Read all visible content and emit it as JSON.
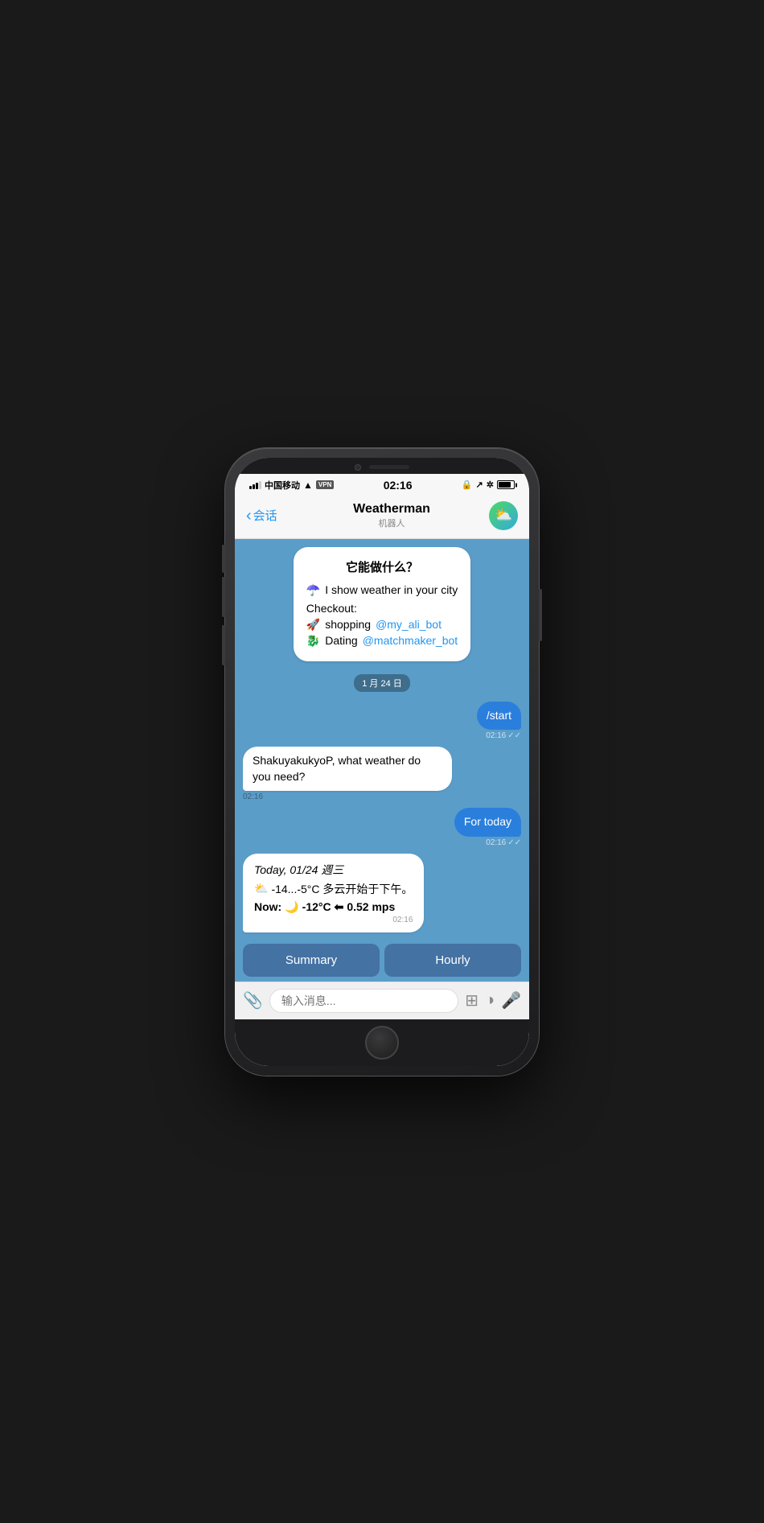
{
  "phone": {
    "camera_area": true
  },
  "status_bar": {
    "carrier": "中国移动",
    "wifi": "wifi",
    "vpn": "VPN",
    "time": "02:16",
    "lock_icon": "🔒",
    "location_icon": "↗",
    "bluetooth_icon": "✲"
  },
  "header": {
    "back_label": "会话",
    "title": "Weatherman",
    "subtitle": "机器人",
    "avatar_icon": "⛅"
  },
  "welcome_bubble": {
    "title": "它能做什么？",
    "line1_emoji": "☂️",
    "line1_text": "I show weather in your city",
    "checkout_label": "Checkout:",
    "item1_emoji": "🚀",
    "item1_text": "shopping",
    "item1_link": "@my_ali_bot",
    "item2_emoji": "🐉",
    "item2_text": "Dating",
    "item2_link": "@matchmaker_bot"
  },
  "date_separator": {
    "label": "1 月 24 日"
  },
  "messages": [
    {
      "id": "msg1",
      "type": "outgoing",
      "text": "/start",
      "time": "02:16",
      "read": true
    },
    {
      "id": "msg2",
      "type": "incoming",
      "text": "ShakuyakukyoP, what weather do you need?",
      "time": "02:16"
    },
    {
      "id": "msg3",
      "type": "outgoing",
      "text": "For today",
      "time": "02:16",
      "read": true
    },
    {
      "id": "msg4",
      "type": "weather",
      "date_line": "Today, 01/24 週三",
      "emoji_cloud": "⛅",
      "temp_range": "-14...-5°C 多云开始于下午。",
      "now_label": "Now:",
      "now_emoji": "🌙",
      "now_temp": "-12°C",
      "wind_emoji": "⬅",
      "wind_speed": "0.52 mps",
      "time": "02:16"
    }
  ],
  "action_buttons": [
    {
      "id": "btn-summary",
      "label": "Summary"
    },
    {
      "id": "btn-hourly",
      "label": "Hourly"
    }
  ],
  "input_bar": {
    "placeholder": "输入消息...",
    "attach_icon": "📎",
    "sticker_icon": "⊞",
    "emoji_icon": "◑",
    "mic_icon": "🎤"
  }
}
